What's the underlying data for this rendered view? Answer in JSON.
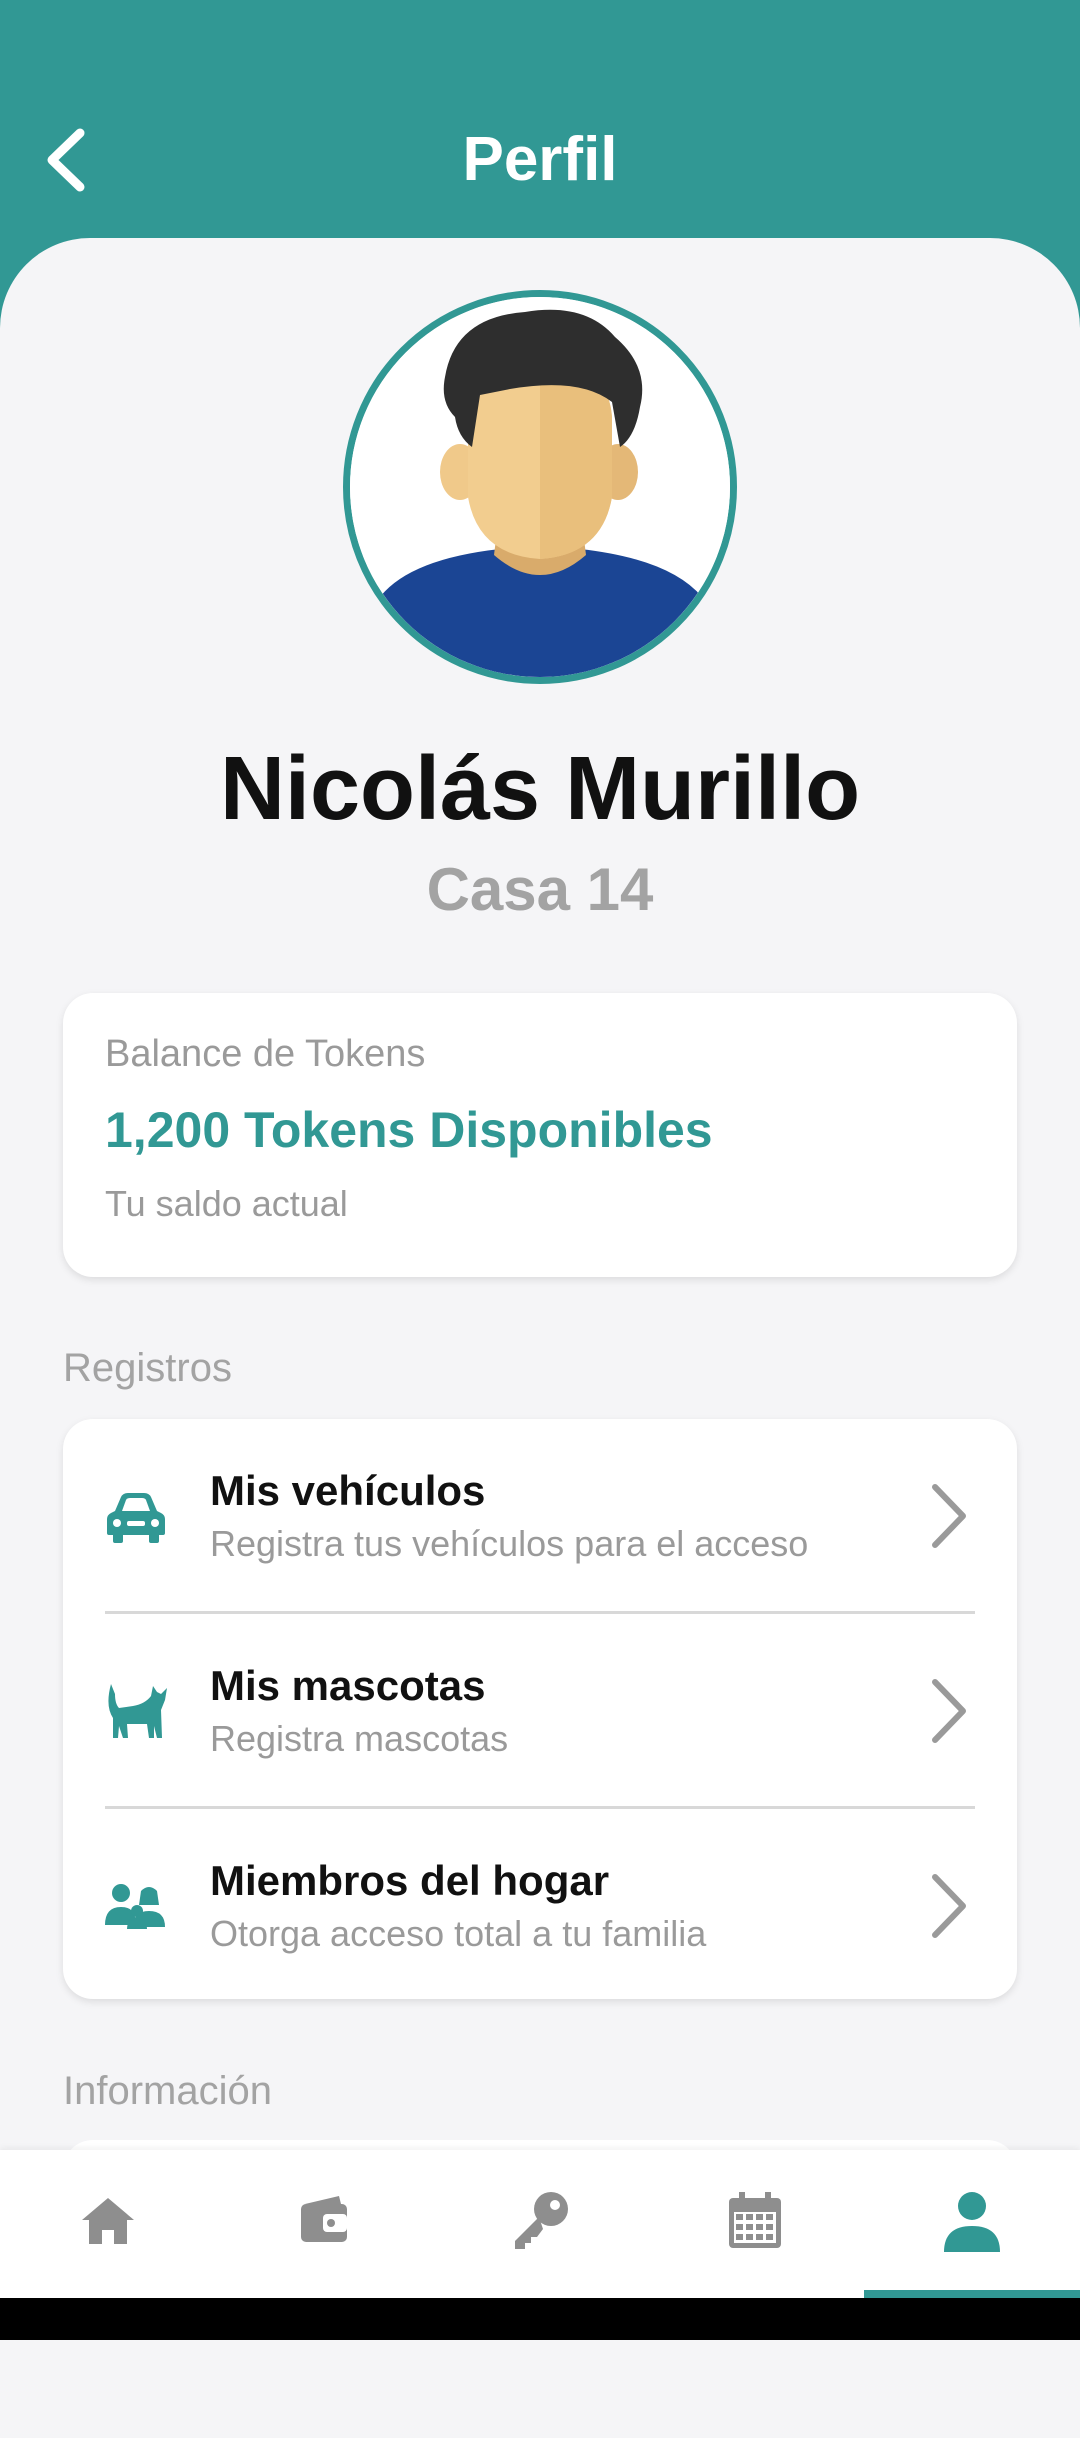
{
  "header": {
    "title": "Perfil",
    "back_icon": "chevron-left-icon"
  },
  "profile": {
    "name": "Nicolás Murillo",
    "unit": "Casa 14"
  },
  "balance": {
    "label": "Balance de Tokens",
    "value": "1,200 Tokens Disponibles",
    "subtitle": "Tu saldo actual"
  },
  "sections": {
    "registros": "Registros",
    "informacion": "Información"
  },
  "registros": [
    {
      "title": "Mis vehículos",
      "subtitle": "Registra tus vehículos para el acceso",
      "icon": "car-icon"
    },
    {
      "title": "Mis mascotas",
      "subtitle": "Registra mascotas",
      "icon": "cat-icon"
    },
    {
      "title": "Miembros del hogar",
      "subtitle": "Otorga acceso total a tu familia",
      "icon": "family-icon"
    }
  ],
  "bottom_nav": [
    {
      "icon": "home-icon",
      "active": false
    },
    {
      "icon": "wallet-icon",
      "active": false
    },
    {
      "icon": "key-icon",
      "active": false
    },
    {
      "icon": "calendar-icon",
      "active": false
    },
    {
      "icon": "user-icon",
      "active": true
    }
  ],
  "colors": {
    "accent": "#319894",
    "background": "#f5f5f7",
    "muted": "#9a9a9a",
    "inactive_icon": "#8e8e8e"
  }
}
